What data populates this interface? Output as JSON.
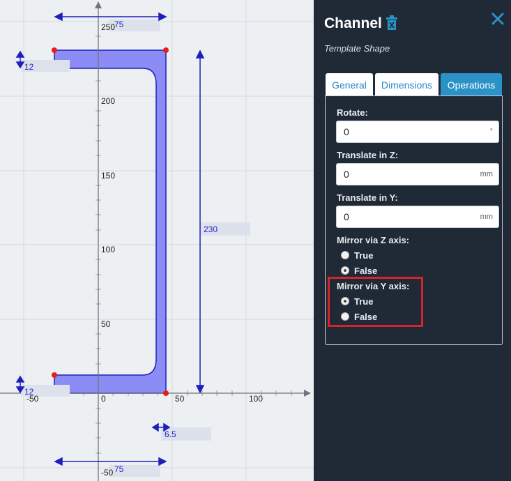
{
  "canvas": {
    "y_ticks": [
      "250",
      "200",
      "150",
      "100",
      "50",
      "-50"
    ],
    "x_ticks": [
      "-50",
      "0",
      "50",
      "100"
    ],
    "dimensions": {
      "top_width": "75",
      "top_flange": "12",
      "height": "230",
      "bottom_flange": "12",
      "web": "6.5",
      "bottom_width": "75"
    }
  },
  "panel": {
    "title": "Channel",
    "subtitle": "Template Shape",
    "tabs": [
      "General",
      "Dimensions",
      "Operations"
    ],
    "active_tab": "Operations",
    "fields": {
      "rotate": {
        "label": "Rotate:",
        "value": "0",
        "unit": "°"
      },
      "translate_z": {
        "label": "Translate in Z:",
        "value": "0",
        "unit": "mm"
      },
      "translate_y": {
        "label": "Translate in Y:",
        "value": "0",
        "unit": "mm"
      }
    },
    "mirror_z": {
      "label": "Mirror via Z axis:",
      "options": [
        "True",
        "False"
      ],
      "selected": "False"
    },
    "mirror_y": {
      "label": "Mirror via Y axis:",
      "options": [
        "True",
        "False"
      ],
      "selected": "True"
    }
  },
  "colors": {
    "accent": "#2a92c6",
    "panel_bg": "#1f2a36",
    "shape_fill": "#8c8cf5",
    "highlight": "#d9222b"
  }
}
